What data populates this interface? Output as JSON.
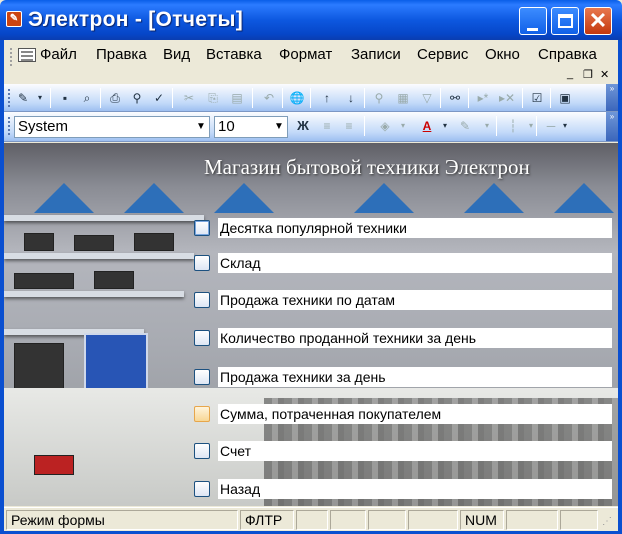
{
  "window": {
    "title": "Электрон - [Отчеты]"
  },
  "menu": {
    "items": [
      "Файл",
      "Правка",
      "Вид",
      "Вставка",
      "Формат",
      "Записи",
      "Сервис",
      "Окно",
      "Справка"
    ]
  },
  "format_toolbar": {
    "font_name": "System",
    "font_size": "10",
    "bold_label": "Ж"
  },
  "form": {
    "title": "Магазин бытовой техники Электрон",
    "reports": [
      "Десятка популярной техники",
      "Склад",
      "Продажа техники по датам",
      "Количество проданной техники за день",
      "Продажа техники за день",
      "Сумма, потраченная покупателем",
      "Счет",
      "Назад"
    ]
  },
  "status": {
    "mode": "Режим формы",
    "filter": "ФЛТР",
    "num": "NUM"
  },
  "colors": {
    "titlebar": "#0a5ee8",
    "close_button": "#c4380e",
    "toolbar": "#c3daf9"
  }
}
